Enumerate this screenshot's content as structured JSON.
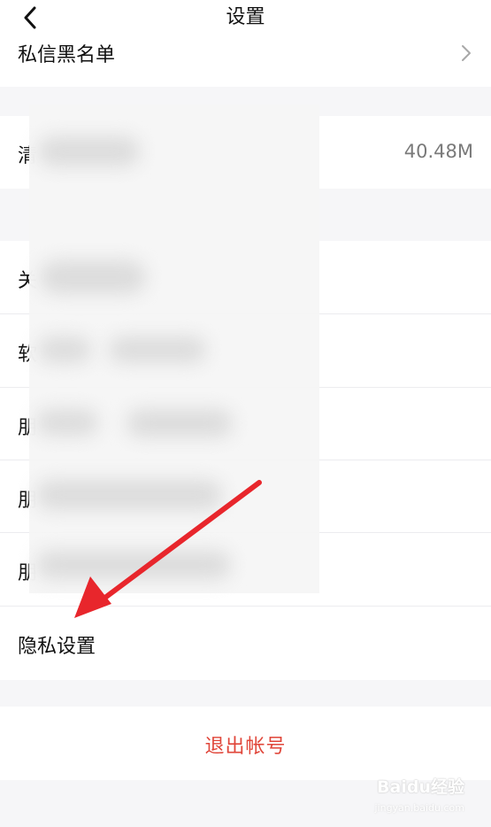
{
  "header": {
    "title": "设置",
    "back_icon": "chevron-left-icon"
  },
  "rows": {
    "dm_blacklist": {
      "label": "私信黑名单",
      "icon": "chevron-right-icon"
    },
    "clear_cache": {
      "label_visible": "清",
      "value": "40.48M"
    },
    "blurred_1": {
      "label_visible": "关"
    },
    "blurred_2": {
      "label_visible": "软"
    },
    "blurred_3": {
      "label_visible": "朋"
    },
    "blurred_4": {
      "label_visible": "朋"
    },
    "blurred_5": {
      "label_visible": "朋"
    },
    "privacy": {
      "label": "隐私设置"
    }
  },
  "logout": {
    "label": "退出帐号"
  },
  "watermark": {
    "text": "Baidu经验",
    "sub": "jingyan.baidu.com"
  },
  "colors": {
    "logout_red": "#e0463a",
    "arrow_red": "#e8262c",
    "background": "#f6f6f8"
  }
}
